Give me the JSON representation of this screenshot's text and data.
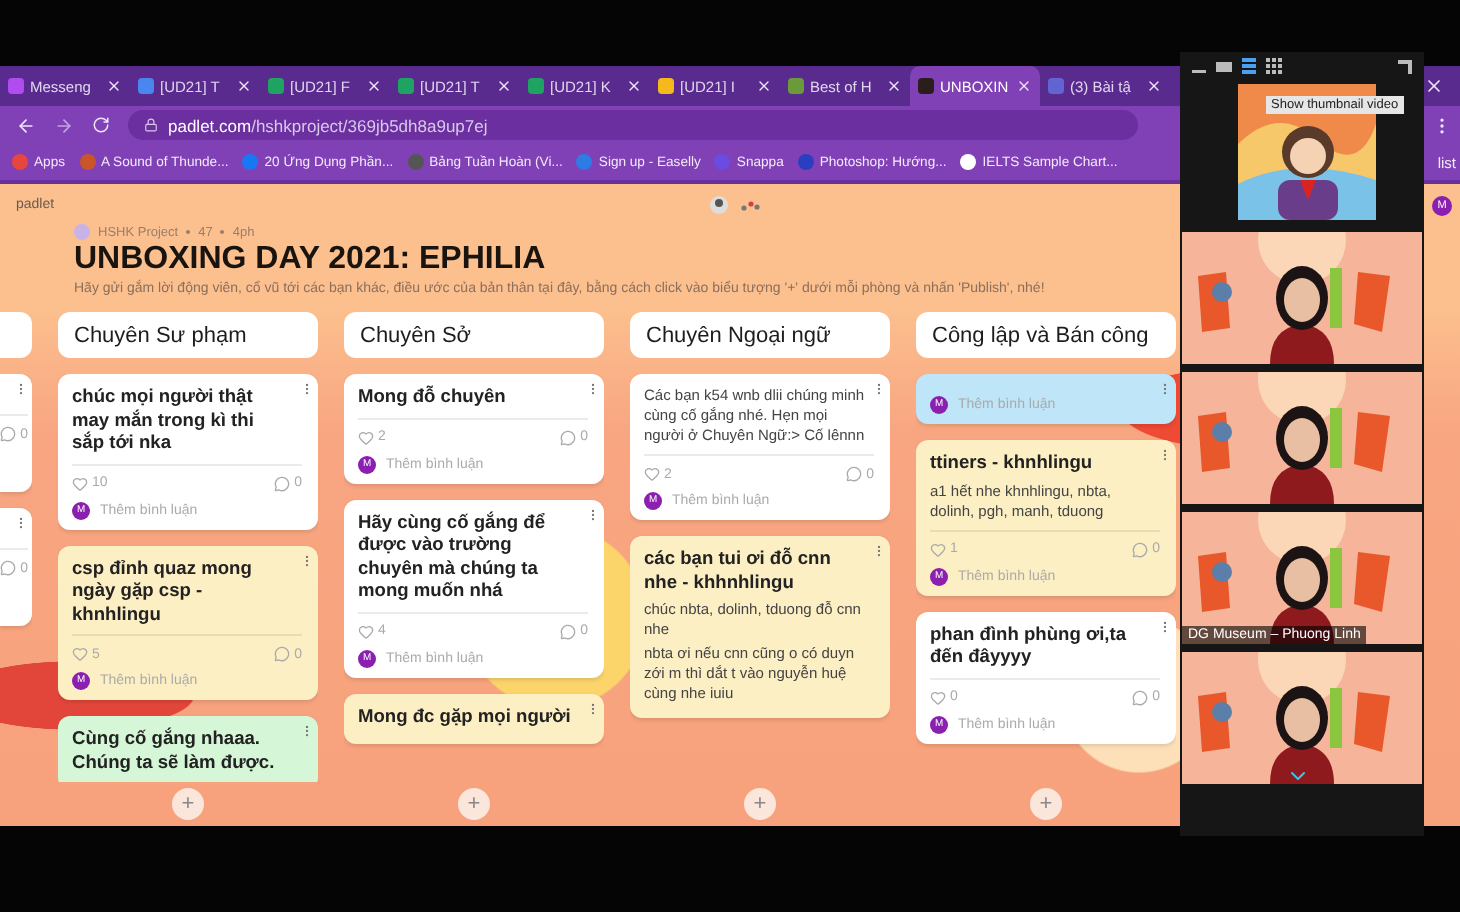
{
  "call_panel": {
    "tooltip": "Show thumbnail video",
    "tiles": [
      {
        "kind": "illustration"
      },
      {
        "kind": "camera"
      },
      {
        "kind": "camera"
      },
      {
        "kind": "camera",
        "name": "DG Museum – Phuong Linh"
      },
      {
        "kind": "camera"
      }
    ]
  },
  "tabs": [
    {
      "label": "Messeng",
      "color": "#b04cf0",
      "selected": false
    },
    {
      "label": "[UD21] T",
      "color": "#4a86f0",
      "selected": false
    },
    {
      "label": "[UD21] F",
      "color": "#1ea362",
      "selected": false
    },
    {
      "label": "[UD21] T",
      "color": "#1ea362",
      "selected": false
    },
    {
      "label": "[UD21] K",
      "color": "#1ea362",
      "selected": false
    },
    {
      "label": "[UD21] I",
      "color": "#f6b91b",
      "selected": false
    },
    {
      "label": "Best of H",
      "color": "#6a9a3a",
      "selected": false
    },
    {
      "label": "UNBOXIN",
      "color": "#2b1d1d",
      "selected": true
    },
    {
      "label": "(3) Bài tậ",
      "color": "#6264d1",
      "selected": false
    }
  ],
  "address_bar": {
    "host": "padlet.com",
    "path": "/hshkproject/369jb5dh8a9up7ej"
  },
  "bookmarks": [
    {
      "label": "Apps",
      "color": "#e8453c"
    },
    {
      "label": "A Sound of Thunde...",
      "color": "#c9552a"
    },
    {
      "label": "20 Ứng Dụng Phần...",
      "color": "#1877f2"
    },
    {
      "label": "Bảng Tuần Hoàn (Vi...",
      "color": "#555555"
    },
    {
      "label": "Sign up - Easelly",
      "color": "#2d7be5"
    },
    {
      "label": "Snappa",
      "color": "#6c4be0"
    },
    {
      "label": "Photoshop: Hướng...",
      "color": "#2a3fbf"
    },
    {
      "label": "IELTS Sample Chart...",
      "color": "#ffffff"
    }
  ],
  "reading_list": "list",
  "profile": "M",
  "padlet": {
    "brand": "padlet",
    "author": "HSHK Project",
    "count": "47",
    "time": "4ph",
    "title": "UNBOXING DAY 2021: EPHILIA",
    "description": "Hãy gửi gắm lời động viên, cổ vũ tới các bạn khác, điều ước của bản thân tại đây, bằng cách click vào biểu tượng '+' dưới mỗi phòng và nhấn 'Publish', nhé!"
  },
  "columns": [
    {
      "kind": "partial",
      "posts": [
        {
          "color": "#ffffff",
          "comments": "0"
        },
        {
          "color": "#ffffff",
          "comments": "0"
        }
      ]
    },
    {
      "kind": "full",
      "heading": "Chuyên Sư phạm",
      "add": "+",
      "posts": [
        {
          "color": "#ffffff",
          "title": "chúc mọi người thật may mắn trong kì thi sắp tới nka",
          "likes": "10",
          "comments": "0",
          "avatar": "M",
          "add_comment": "Thêm bình luận"
        },
        {
          "color": "#fdefc4",
          "title": "csp đỉnh quaz mong ngày gặp csp - khnhlingu",
          "likes": "5",
          "comments": "0",
          "avatar": "M",
          "add_comment": "Thêm bình luận"
        },
        {
          "color": "#d6f6d8",
          "title": "Cùng cố gắng nhaaa. Chúng ta sẽ làm được."
        }
      ]
    },
    {
      "kind": "full",
      "heading": "Chuyên Sở",
      "add": "+",
      "posts": [
        {
          "color": "#ffffff",
          "title": "Mong đỗ chuyên",
          "likes": "2",
          "comments": "0",
          "avatar": "M",
          "add_comment": "Thêm bình luận"
        },
        {
          "color": "#ffffff",
          "title": "Hãy cùng cố gắng để được vào trường chuyên mà chúng ta mong muốn nhá",
          "likes": "4",
          "comments": "0",
          "avatar": "M",
          "add_comment": "Thêm bình luận"
        },
        {
          "color": "#fdefc4",
          "title": "Mong đc gặp mọi người"
        }
      ]
    },
    {
      "kind": "full",
      "heading": "Chuyên Ngoại ngữ",
      "add": "+",
      "posts": [
        {
          "color": "#ffffff",
          "body": [
            "Các bạn k54 wnb dlii chúng minh cùng cố gắng nhé. Hẹn mọi người ở Chuyên Ngữ:> Cố lênnn"
          ],
          "likes": "2",
          "comments": "0",
          "avatar": "M",
          "add_comment": "Thêm bình luận"
        },
        {
          "color": "#fdefc4",
          "title": "các bạn tui ơi đỗ cnn nhe - khhnhlingu",
          "body": [
            "chúc nbta, dolinh, tduong đỗ cnn nhe",
            "nbta ơi nếu cnn cũng o có duyn zới m thì dắt t vào nguyễn huệ cùng nhe iuiu"
          ]
        }
      ]
    },
    {
      "kind": "full",
      "heading": "Công lập và Bán công",
      "add": "+",
      "posts": [
        {
          "color": "#bfe5f8",
          "avatar": "M",
          "add_comment": "Thêm bình luận"
        },
        {
          "color": "#fdefc4",
          "title": "ttiners - khnhlingu",
          "body": [
            "a1 hết nhe khnhlingu, nbta, dolinh, pgh, manh, tduong"
          ],
          "likes": "1",
          "comments": "0",
          "avatar": "M",
          "add_comment": "Thêm bình luận"
        },
        {
          "color": "#ffffff",
          "title": "phan đình phùng ơi,ta đến đâyyyy",
          "likes": "0",
          "comments": "0",
          "avatar": "M",
          "add_comment": "Thêm bình luận"
        }
      ]
    }
  ]
}
